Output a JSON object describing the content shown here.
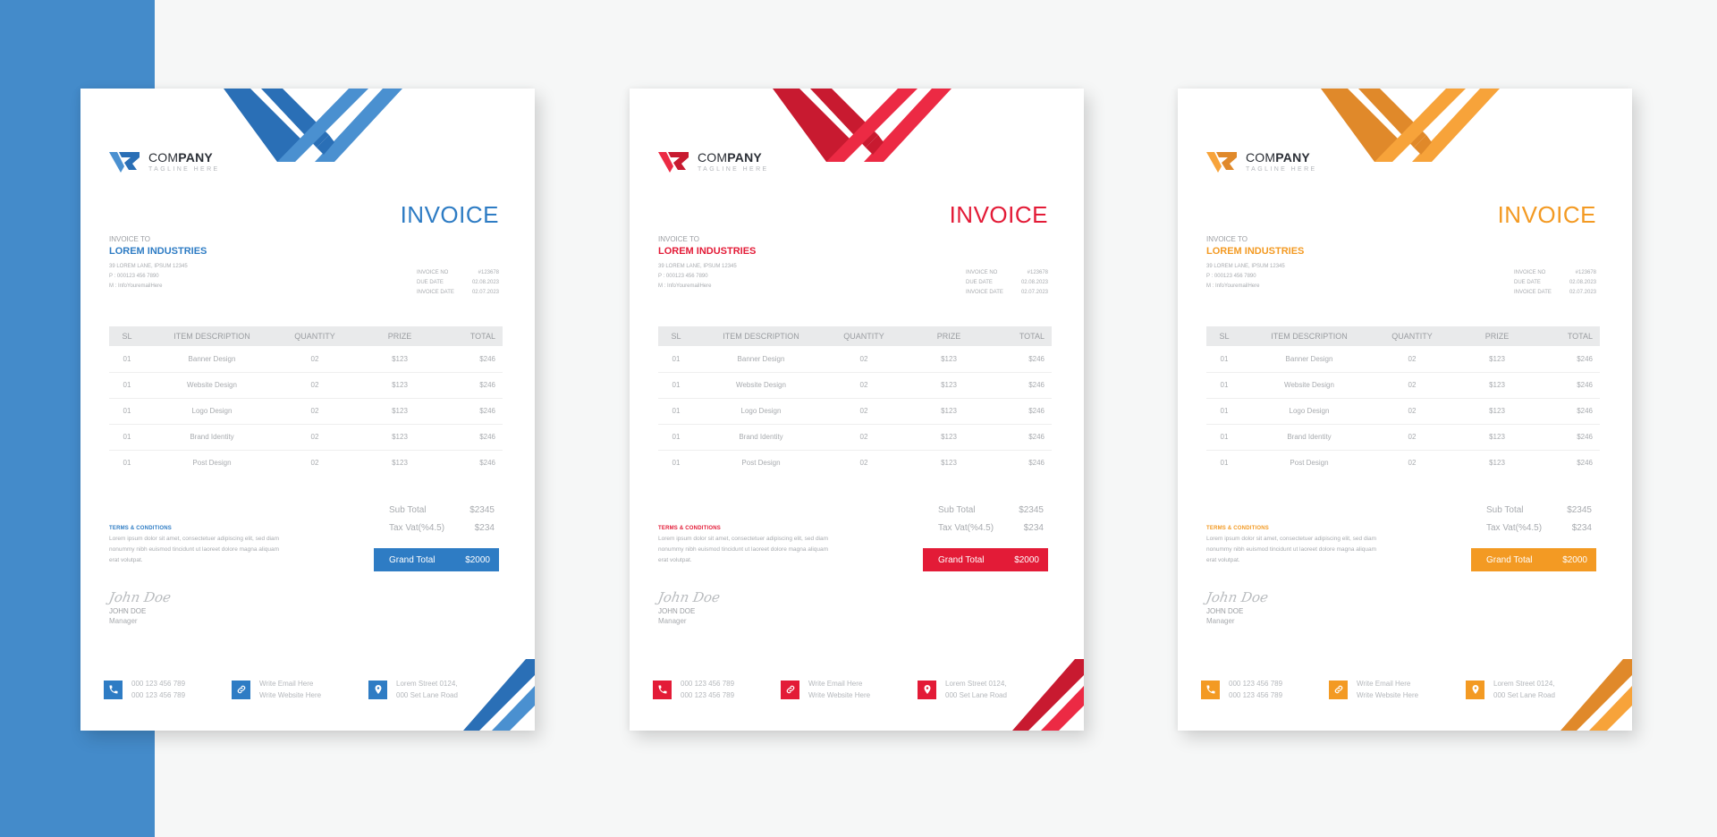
{
  "templates": [
    {
      "variant": "blue",
      "accent": "#2e7cc4",
      "accent_dark": "#2a6fb6",
      "accent_light": "#4a90d0",
      "company": {
        "name_regular": "COM",
        "name_bold": "PANY",
        "tagline": "TAGLINE HERE"
      },
      "title": "INVOICE",
      "bill_to": {
        "label": "INVOICE TO",
        "name": "LOREM INDUSTRIES",
        "lines": [
          "39 LOREM LANE, IPSUM 12345",
          "P : 000123 456 7890",
          "M : InfoYouremailHere"
        ]
      },
      "meta": [
        {
          "key": "INVOICE NO",
          "value": "#123678"
        },
        {
          "key": "DUE DATE",
          "value": "02.08.2023"
        },
        {
          "key": "INVOICE DATE",
          "value": "02.07.2023"
        }
      ]
    },
    {
      "variant": "red",
      "accent": "#e31b37",
      "accent_dark": "#c81a30",
      "accent_light": "#ec2a44",
      "company": {
        "name_regular": "COM",
        "name_bold": "PANY",
        "tagline": "TAGLINE HERE"
      },
      "title": "INVOICE",
      "bill_to": {
        "label": "INVOICE TO",
        "name": "LOREM INDUSTRIES",
        "lines": [
          "39 LOREM LANE, IPSUM 12345",
          "P : 000123 456 7890",
          "M : InfoYouremailHere"
        ]
      },
      "meta": [
        {
          "key": "INVOICE NO",
          "value": "#123678"
        },
        {
          "key": "DUE DATE",
          "value": "02.08.2023"
        },
        {
          "key": "INVOICE DATE",
          "value": "02.07.2023"
        }
      ]
    },
    {
      "variant": "orange",
      "accent": "#f39a23",
      "accent_dark": "#e0892a",
      "accent_light": "#f7a33a",
      "company": {
        "name_regular": "COM",
        "name_bold": "PANY",
        "tagline": "TAGLINE HERE"
      },
      "title": "INVOICE",
      "bill_to": {
        "label": "INVOICE TO",
        "name": "LOREM INDUSTRIES",
        "lines": [
          "39 LOREM LANE, IPSUM 12345",
          "P : 000123 456 7890",
          "M : InfoYouremailHere"
        ]
      },
      "meta": [
        {
          "key": "INVOICE NO",
          "value": "#123678"
        },
        {
          "key": "DUE DATE",
          "value": "02.08.2023"
        },
        {
          "key": "INVOICE DATE",
          "value": "02.07.2023"
        }
      ]
    }
  ],
  "table": {
    "headers": [
      "SL",
      "ITEM DESCRIPTION",
      "QUANTITY",
      "PRIZE",
      "TOTAL"
    ],
    "rows": [
      [
        "01",
        "Banner Design",
        "02",
        "$123",
        "$246"
      ],
      [
        "01",
        "Website Design",
        "02",
        "$123",
        "$246"
      ],
      [
        "01",
        "Logo Design",
        "02",
        "$123",
        "$246"
      ],
      [
        "01",
        "Brand Identity",
        "02",
        "$123",
        "$246"
      ],
      [
        "01",
        "Post Design",
        "02",
        "$123",
        "$246"
      ]
    ]
  },
  "totals": {
    "sub_total_label": "Sub Total",
    "sub_total_value": "$2345",
    "tax_label": "Tax Vat(%4.5)",
    "tax_value": "$234",
    "grand_total_label": "Grand Total",
    "grand_total_value": "$2000"
  },
  "terms": {
    "title": "TERMS & CONDITIONS",
    "text": "Lorem ipsum dolor sit amet, consectetuer adipiscing elit, sed diam nonummy nibh euismod tincidunt ut laoreet dolore magna aliquam erat volutpat."
  },
  "signature": {
    "script": "John Doe",
    "name": "JOHN DOE",
    "role": "Manager"
  },
  "footer": [
    {
      "icon": "phone-icon",
      "lines": [
        "000 123 456 789",
        "000 123 456 789"
      ]
    },
    {
      "icon": "link-icon",
      "lines": [
        "Write Email Here",
        "Write Website Here"
      ]
    },
    {
      "icon": "location-pin-icon",
      "lines": [
        "Lorem Street 0124,",
        "000 Set Lane Road"
      ]
    }
  ]
}
